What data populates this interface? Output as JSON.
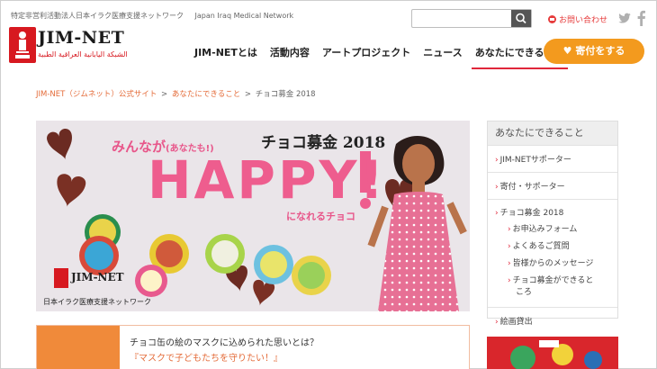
{
  "header": {
    "tagline": "特定非営利活動法人日本イラク医療支援ネットワーク",
    "tagline_en": "Japan Iraq Medical Network",
    "logo_text": "JIM-NET",
    "logo_arabic": "الشبكة اليابانية العراقية الطبية",
    "search_placeholder": "",
    "contact_label": "お問い合わせ",
    "donate_label": "寄付をする"
  },
  "nav": {
    "items": [
      {
        "label": "JIM-NETとは",
        "active": false
      },
      {
        "label": "活動内容",
        "active": false
      },
      {
        "label": "アートプロジェクト",
        "active": false
      },
      {
        "label": "ニュース",
        "active": false
      },
      {
        "label": "あなたにできること",
        "active": true
      }
    ]
  },
  "breadcrumb": {
    "home": "JIM-NET（ジムネット）公式サイト",
    "parent": "あなたにできること",
    "current": "チョコ募金 2018",
    "separator": ">"
  },
  "hero": {
    "line1": "みんなが",
    "line1_small": "(あなたも!)",
    "campaign": "チョコ募金 2018",
    "headline": "HAPPY!",
    "line2": "になれるチョコ",
    "logo_text": "JIM-NET",
    "org_name": "日本イラク医療支援ネットワーク"
  },
  "sidebar": {
    "heading": "あなたにできること",
    "items": [
      {
        "label": "JIM-NETサポーター"
      },
      {
        "label": "寄付・サポーター"
      }
    ],
    "group": {
      "label": "チョコ募金 2018",
      "subitems": [
        {
          "label": "お申込みフォーム"
        },
        {
          "label": "よくあるご質問"
        },
        {
          "label": "皆様からのメッセージ"
        },
        {
          "label": "チョコ募金ができると"
        },
        {
          "label": "ころ"
        }
      ]
    },
    "last_item": {
      "label": "絵画貸出"
    }
  },
  "teaser": {
    "title": "チョコ缶の絵のマスクに込められた思いとは？",
    "subtitle": "『マスクで子どもたちを守りたい！』"
  },
  "colors": {
    "accent_red": "#e0273a",
    "donate_orange": "#f39a1e",
    "hero_pink": "#ee5d8e",
    "teaser_orange": "#f08a3a"
  }
}
